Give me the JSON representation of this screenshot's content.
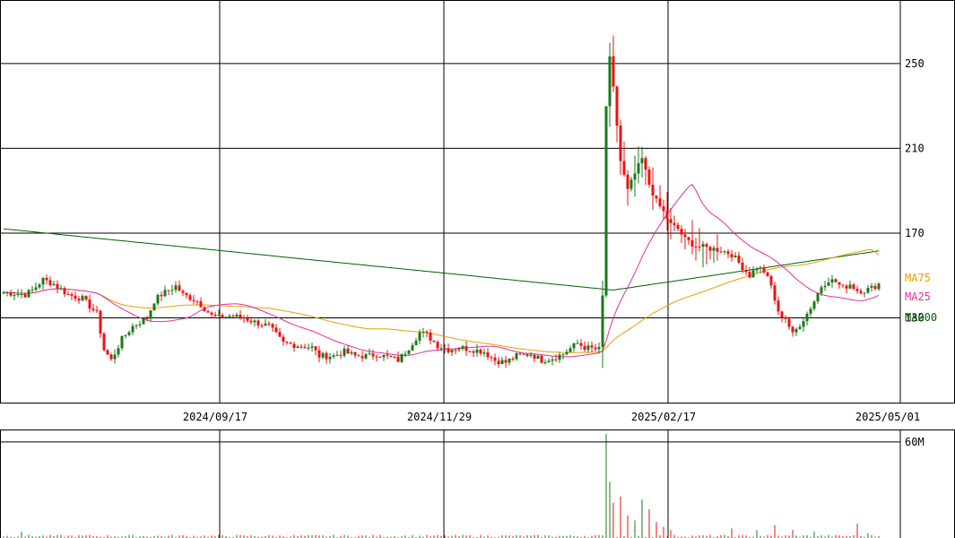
{
  "chart_data": [
    {
      "type": "candlestick",
      "ylim": [
        90,
        280
      ],
      "y_ticks": [
        130,
        170,
        210,
        250
      ],
      "y_tick_labels": [
        "130",
        "170",
        "210",
        "250"
      ],
      "x_ticks": [
        "2024/09/17",
        "2024/11/29",
        "2025/02/17",
        "2025/05/01"
      ],
      "legend": [
        {
          "label": "MA75",
          "color": "#e8a000"
        },
        {
          "label": "MA25",
          "color": "#e0309c"
        },
        {
          "label": "MA200",
          "color": "#006400"
        }
      ],
      "colors": {
        "up": "#1a7a1a",
        "down": "#ee1111",
        "ma25": "#e0309c",
        "ma75": "#e8a000",
        "ma200": "#006400"
      },
      "price_anchors": [
        [
          0,
          142
        ],
        [
          6,
          141
        ],
        [
          8,
          143
        ],
        [
          11,
          148
        ],
        [
          14,
          146
        ],
        [
          18,
          141
        ],
        [
          22,
          139
        ],
        [
          26,
          132
        ],
        [
          28,
          115
        ],
        [
          30,
          110
        ],
        [
          33,
          120
        ],
        [
          36,
          126
        ],
        [
          40,
          130
        ],
        [
          42,
          138
        ],
        [
          44,
          141
        ],
        [
          48,
          145
        ],
        [
          50,
          141
        ],
        [
          54,
          138
        ],
        [
          58,
          131
        ],
        [
          60,
          130
        ],
        [
          63,
          131
        ],
        [
          67,
          130
        ],
        [
          70,
          128
        ],
        [
          74,
          126
        ],
        [
          78,
          118
        ],
        [
          82,
          117
        ],
        [
          86,
          116
        ],
        [
          88,
          112
        ],
        [
          92,
          112
        ],
        [
          95,
          114
        ],
        [
          98,
          112
        ],
        [
          102,
          112
        ],
        [
          104,
          113
        ],
        [
          106,
          112
        ],
        [
          110,
          110
        ],
        [
          113,
          116
        ],
        [
          116,
          123
        ],
        [
          118,
          122
        ],
        [
          121,
          117
        ],
        [
          124,
          115
        ],
        [
          127,
          116
        ],
        [
          131,
          115
        ],
        [
          134,
          114
        ],
        [
          137,
          110
        ],
        [
          140,
          109
        ],
        [
          143,
          112
        ],
        [
          147,
          113
        ],
        [
          150,
          110
        ],
        [
          153,
          111
        ],
        [
          156,
          113
        ],
        [
          160,
          118
        ],
        [
          162,
          116
        ],
        [
          166,
          115
        ],
        [
          167,
          140
        ],
        [
          168,
          230
        ],
        [
          169,
          252
        ],
        [
          170,
          238
        ],
        [
          172,
          204
        ],
        [
          174,
          190
        ],
        [
          176,
          198
        ],
        [
          178,
          205
        ],
        [
          180,
          193
        ],
        [
          182,
          185
        ],
        [
          184,
          180
        ],
        [
          186,
          174
        ],
        [
          188,
          172
        ],
        [
          190,
          167
        ],
        [
          193,
          164
        ],
        [
          196,
          163
        ],
        [
          200,
          162
        ],
        [
          203,
          160
        ],
        [
          206,
          154
        ],
        [
          208,
          150
        ],
        [
          210,
          154
        ],
        [
          212,
          152
        ],
        [
          214,
          145
        ],
        [
          216,
          132
        ],
        [
          218,
          130
        ],
        [
          220,
          122
        ],
        [
          222,
          127
        ],
        [
          224,
          132
        ],
        [
          226,
          138
        ],
        [
          228,
          145
        ],
        [
          230,
          148
        ],
        [
          232,
          147
        ],
        [
          234,
          144
        ],
        [
          236,
          146
        ],
        [
          238,
          143
        ],
        [
          240,
          143
        ],
        [
          242,
          144
        ],
        [
          244,
          146
        ]
      ],
      "volume": {
        "ylim": [
          0,
          65
        ],
        "y_tick": 60,
        "y_tick_label": "60M",
        "spikes": [
          [
            5,
            4
          ],
          [
            168,
            65
          ],
          [
            169,
            35
          ],
          [
            170,
            22
          ],
          [
            172,
            26
          ],
          [
            174,
            14
          ],
          [
            176,
            11
          ],
          [
            178,
            24
          ],
          [
            180,
            18
          ],
          [
            182,
            10
          ],
          [
            184,
            7
          ],
          [
            186,
            5
          ],
          [
            203,
            6
          ],
          [
            210,
            5
          ],
          [
            215,
            8
          ],
          [
            220,
            5
          ],
          [
            226,
            4
          ],
          [
            238,
            9
          ],
          [
            241,
            3
          ]
        ]
      }
    }
  ]
}
